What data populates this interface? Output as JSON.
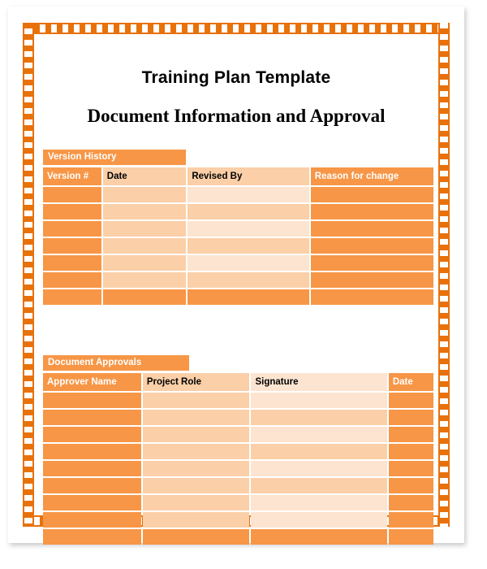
{
  "document": {
    "title": "Training Plan Template",
    "subtitle": "Document Information and Approval"
  },
  "theme": {
    "accent_dark": "#F79646",
    "accent_mid": "#FBCFA8",
    "accent_light": "#FDE4D0",
    "frame_orange": "#E8710A",
    "page_background": "#FFFFFF",
    "text_dark": "#000000",
    "text_on_accent": "#FFFFFF"
  },
  "version_history": {
    "section_label": "Version History",
    "columns": [
      {
        "header": "Version #",
        "style": "dark"
      },
      {
        "header": "Date",
        "style": "mid"
      },
      {
        "header": "Revised By",
        "style": "mid"
      },
      {
        "header": "Reason for change",
        "style": "dark"
      }
    ],
    "rows": [
      {
        "version": "",
        "date": "",
        "revised_by": "",
        "reason": ""
      },
      {
        "version": "",
        "date": "",
        "revised_by": "",
        "reason": ""
      },
      {
        "version": "",
        "date": "",
        "revised_by": "",
        "reason": ""
      },
      {
        "version": "",
        "date": "",
        "revised_by": "",
        "reason": ""
      },
      {
        "version": "",
        "date": "",
        "revised_by": "",
        "reason": ""
      },
      {
        "version": "",
        "date": "",
        "revised_by": "",
        "reason": ""
      }
    ],
    "footer_row": {
      "version": "",
      "date": "",
      "revised_by": "",
      "reason": ""
    }
  },
  "document_approvals": {
    "section_label": "Document Approvals",
    "columns": [
      {
        "header": "Approver Name",
        "style": "dark"
      },
      {
        "header": "Project Role",
        "style": "mid"
      },
      {
        "header": "Signature",
        "style": "light"
      },
      {
        "header": "Date",
        "style": "dark"
      }
    ],
    "rows": [
      {
        "approver_name": "",
        "project_role": "",
        "signature": "",
        "date": ""
      },
      {
        "approver_name": "",
        "project_role": "",
        "signature": "",
        "date": ""
      },
      {
        "approver_name": "",
        "project_role": "",
        "signature": "",
        "date": ""
      },
      {
        "approver_name": "",
        "project_role": "",
        "signature": "",
        "date": ""
      },
      {
        "approver_name": "",
        "project_role": "",
        "signature": "",
        "date": ""
      },
      {
        "approver_name": "",
        "project_role": "",
        "signature": "",
        "date": ""
      },
      {
        "approver_name": "",
        "project_role": "",
        "signature": "",
        "date": ""
      },
      {
        "approver_name": "",
        "project_role": "",
        "signature": "",
        "date": ""
      }
    ],
    "footer_row": {
      "approver_name": "",
      "project_role": "",
      "signature": "",
      "date": ""
    }
  }
}
